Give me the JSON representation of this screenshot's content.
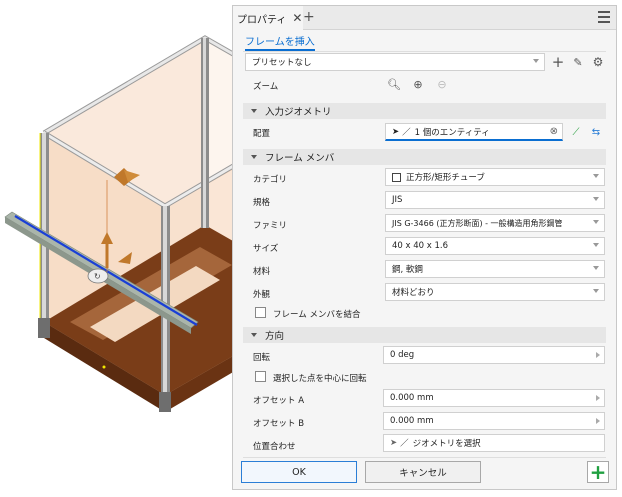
{
  "panel": {
    "tab_title": "プロパティ",
    "insert_frame_link": "フレームを挿入",
    "preset": "プリセットなし",
    "zoom_label": "ズーム"
  },
  "input_geometry": {
    "header": "入力ジオメトリ",
    "placement_label": "配置",
    "placement_value": "1 個のエンティティ"
  },
  "frame_member": {
    "header": "フレーム メンバ",
    "category_label": "カテゴリ",
    "category_value": "正方形/矩形チューブ",
    "standard_label": "規格",
    "standard_value": "JIS",
    "family_label": "ファミリ",
    "family_value": "JIS G-3466 (正方形断面) - 一般構造用角形鋼管",
    "size_label": "サイズ",
    "size_value": "40 x 40 x 1.6",
    "material_label": "材料",
    "material_value": "鋼, 軟鋼",
    "appearance_label": "外観",
    "appearance_value": "材料どおり",
    "combine_label": "フレーム メンバを結合"
  },
  "orientation": {
    "header": "方向",
    "rotation_label": "回転",
    "rotation_value": "0 deg",
    "rotate_about_point_label": "選択した点を中心に回転",
    "offset_a_label": "オフセット A",
    "offset_a_value": "0.000 mm",
    "offset_b_label": "オフセット B",
    "offset_b_value": "0.000 mm",
    "alignment_label": "位置合わせ",
    "alignment_value": "ジオメトリを選択"
  },
  "footer": {
    "ok_label": "OK",
    "cancel_label": "キャンセル"
  },
  "colors": {
    "accent": "#0a6ed1",
    "frame_base": "#6b3414",
    "panel_glass": "#f6d9c0",
    "green_add": "#20a040"
  }
}
